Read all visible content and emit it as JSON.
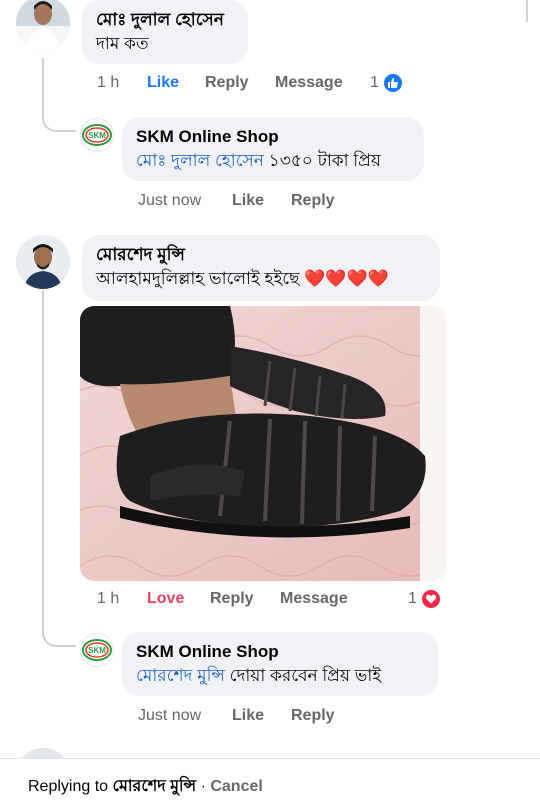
{
  "comments": [
    {
      "author": "মোঃ দুলাল হোসেন",
      "text": "দাম কত",
      "time": "1 h",
      "like_label": "Like",
      "reply_label": "Reply",
      "message_label": "Message",
      "reaction_count": "1",
      "reaction_type": "like-icon",
      "reply": {
        "author": "SKM Online Shop",
        "mention": "মোঃ দুলাল হোসেন",
        "text": " ১৩৫০ টাকা প্রিয়",
        "time": "Just now",
        "like_label": "Like",
        "reply_label": "Reply"
      }
    },
    {
      "author": "মোরশেদ মুন্সি",
      "text": "আলহামদুলিল্লাহ ভালোই হইছে ❤️❤️❤️❤️",
      "time": "1 h",
      "like_label": "Love",
      "reply_label": "Reply",
      "message_label": "Message",
      "reaction_count": "1",
      "reaction_type": "love-icon",
      "reply": {
        "author": "SKM Online Shop",
        "mention": "মোরশেদ মুন্সি",
        "text": " দোয়া করবেন প্রিয় ভাই",
        "time": "Just now",
        "like_label": "Like",
        "reply_label": "Reply"
      }
    }
  ],
  "shop_logo_text": "SKM",
  "reply_bar": {
    "prefix": "Replying to ",
    "name": "মোরশেদ মুন্সি",
    "separator": " · ",
    "cancel": "Cancel"
  },
  "colors": {
    "bubble": "#f0f2f5",
    "link_blue": "#1877f2",
    "love_red": "#f02849",
    "muted": "#65676b"
  }
}
